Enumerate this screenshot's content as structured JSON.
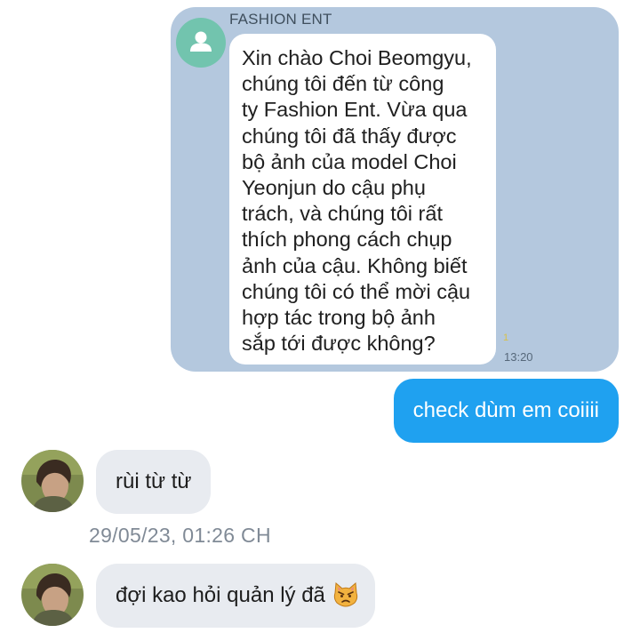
{
  "shared_message": {
    "sender_name": "FASHION ENT",
    "avatar_icon": "person-icon",
    "text": "Xin chào Choi Beomgyu,\nchúng tôi đến từ công\nty Fashion Ent. Vừa qua\nchúng tôi đã thấy được\nbộ ảnh của model Choi\nYeonjun do cậu phụ\ntrách, và chúng tôi rất\nthích phong cách chụp\nảnh của cậu. Không biết\nchúng tôi có thể mời cậu\nhợp tác trong bộ ảnh\nsắp tới được không?",
    "unread_count": "1",
    "time": "13:20"
  },
  "outgoing_message": {
    "text": "check dùm em coiiii"
  },
  "incoming_messages": [
    {
      "text": "rùi từ từ"
    },
    {
      "text": "đợi kao hỏi quản lý đã",
      "emoji": "angry-cat-emoji-icon"
    }
  ],
  "separator_timestamp": "29/05/23, 01:26 CH",
  "colors": {
    "shared_block_bg": "#b4c8de",
    "outgoing_bubble": "#1fa1f0",
    "incoming_bubble": "#e8ebf0",
    "avatar_placeholder": "#72c4ae"
  }
}
